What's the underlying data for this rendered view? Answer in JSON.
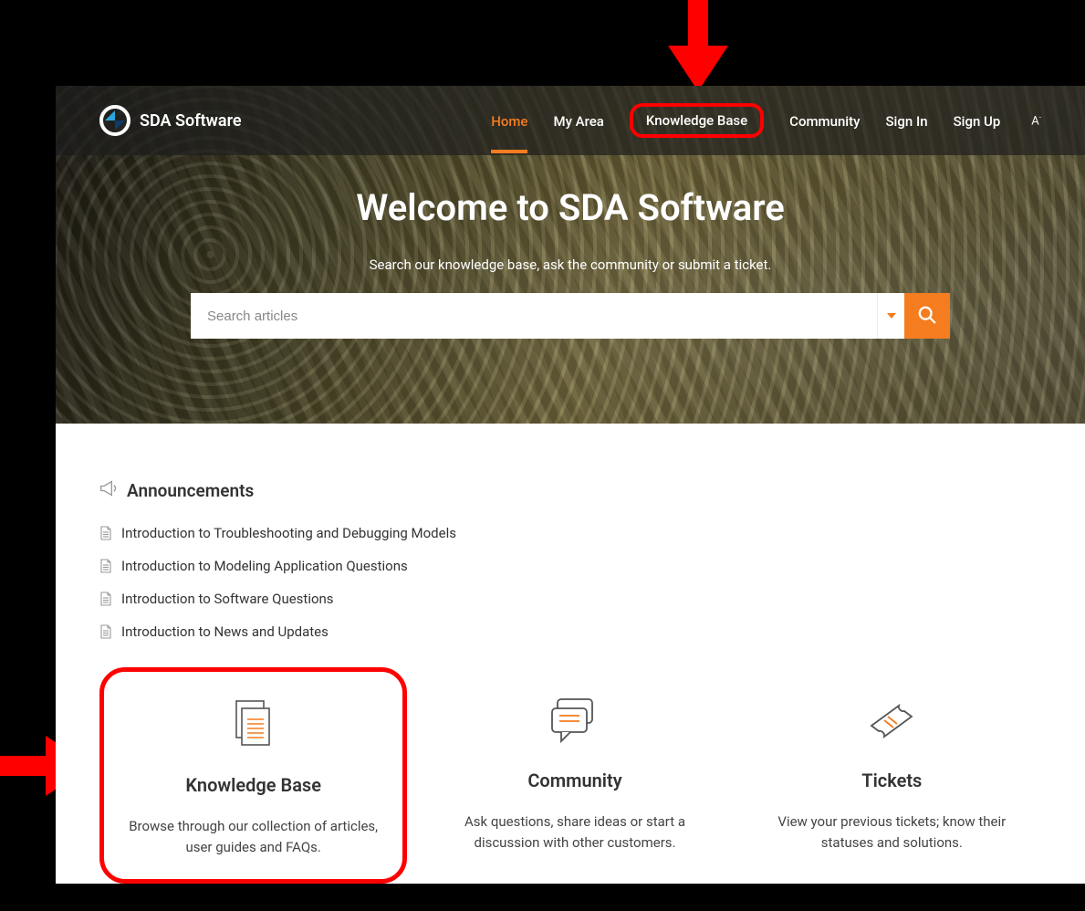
{
  "brand": {
    "name": "SDA Software"
  },
  "nav": {
    "home": "Home",
    "myarea": "My Area",
    "kb": "Knowledge Base",
    "community": "Community",
    "signin": "Sign In",
    "signup": "Sign Up"
  },
  "hero": {
    "title": "Welcome to SDA Software",
    "subtitle": "Search our knowledge base, ask the community or submit a ticket.",
    "search_placeholder": "Search articles"
  },
  "announcements": {
    "heading": "Announcements",
    "items": [
      "Introduction to Troubleshooting and Debugging Models",
      "Introduction to Modeling Application Questions",
      "Introduction to Software Questions",
      "Introduction to News and Updates"
    ]
  },
  "cards": {
    "kb": {
      "title": "Knowledge Base",
      "desc": "Browse through our collection of articles, user guides and FAQs."
    },
    "community": {
      "title": "Community",
      "desc": "Ask questions, share ideas or start a discussion with other customers."
    },
    "tickets": {
      "title": "Tickets",
      "desc": "View your previous tickets; know their statuses and solutions."
    }
  },
  "colors": {
    "accent": "#f57c1f",
    "highlight": "#ff0000"
  }
}
